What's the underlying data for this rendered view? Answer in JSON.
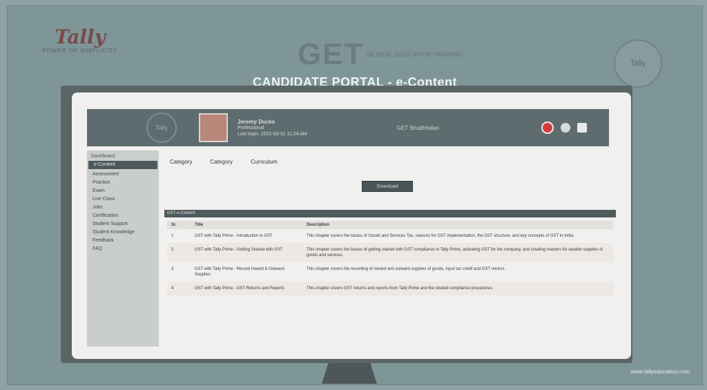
{
  "slide": {
    "tally_logo": "Tally",
    "tally_tagline": "POWER OF SIMPLICITY",
    "get_logo": "GET",
    "get_sub": "GLOBAL EDUCATION TRAINING",
    "corner_badge": "Tally",
    "title": "CANDIDATE PORTAL - e-Content",
    "footer_url": "www.tallyeducation.com"
  },
  "header": {
    "logo": "Tally",
    "user_name": "Jeremy Ducks",
    "user_role": "Professional",
    "user_meta": "Last login: 2021-03-31 11:24 AM",
    "center_text": "GET Shudhhalan"
  },
  "sidebar": {
    "heading": "Dashboard",
    "items": [
      {
        "label": "e-Content",
        "active": true
      },
      {
        "label": "Assessment",
        "active": false
      },
      {
        "label": "Practice",
        "active": false
      },
      {
        "label": "Exam",
        "active": false
      },
      {
        "label": "Live Class",
        "active": false
      },
      {
        "label": "Jobs",
        "active": false
      },
      {
        "label": "Certification",
        "active": false
      },
      {
        "label": "Student Support",
        "active": false
      },
      {
        "label": "Student Knowledge",
        "active": false
      },
      {
        "label": "Feedback",
        "active": false
      },
      {
        "label": "FAQ",
        "active": false
      }
    ]
  },
  "content": {
    "tabs": [
      "Category",
      "Category",
      "Curriculum"
    ],
    "download_button": "Download",
    "section_title": "GST e-Content",
    "table": {
      "headers": [
        "Sr.",
        "Title",
        "Description"
      ],
      "rows": [
        {
          "sn": "1",
          "title": "GST with Tally Prime - Introduction to GST",
          "desc": "This chapter covers the basics of Goods and Services Tax, reasons for GST implementation, the GST structure, and key concepts of GST in India."
        },
        {
          "sn": "2",
          "title": "GST with Tally Prime - Getting Started with GST",
          "desc": "This chapter covers the basics of getting started with GST compliance in Tally Prime, activating GST for the company, and creating masters for taxable supplies of goods and services."
        },
        {
          "sn": "3",
          "title": "GST with Tally Prime - Record Inward & Outward Supplies",
          "desc": "This chapter covers the recording of inward and outward supplies of goods, input tax credit and GST returns."
        },
        {
          "sn": "4",
          "title": "GST with Tally Prime - GST Returns and Reports",
          "desc": "This chapter covers GST returns and reports from Tally Prime and the related compliance procedures."
        }
      ]
    }
  }
}
